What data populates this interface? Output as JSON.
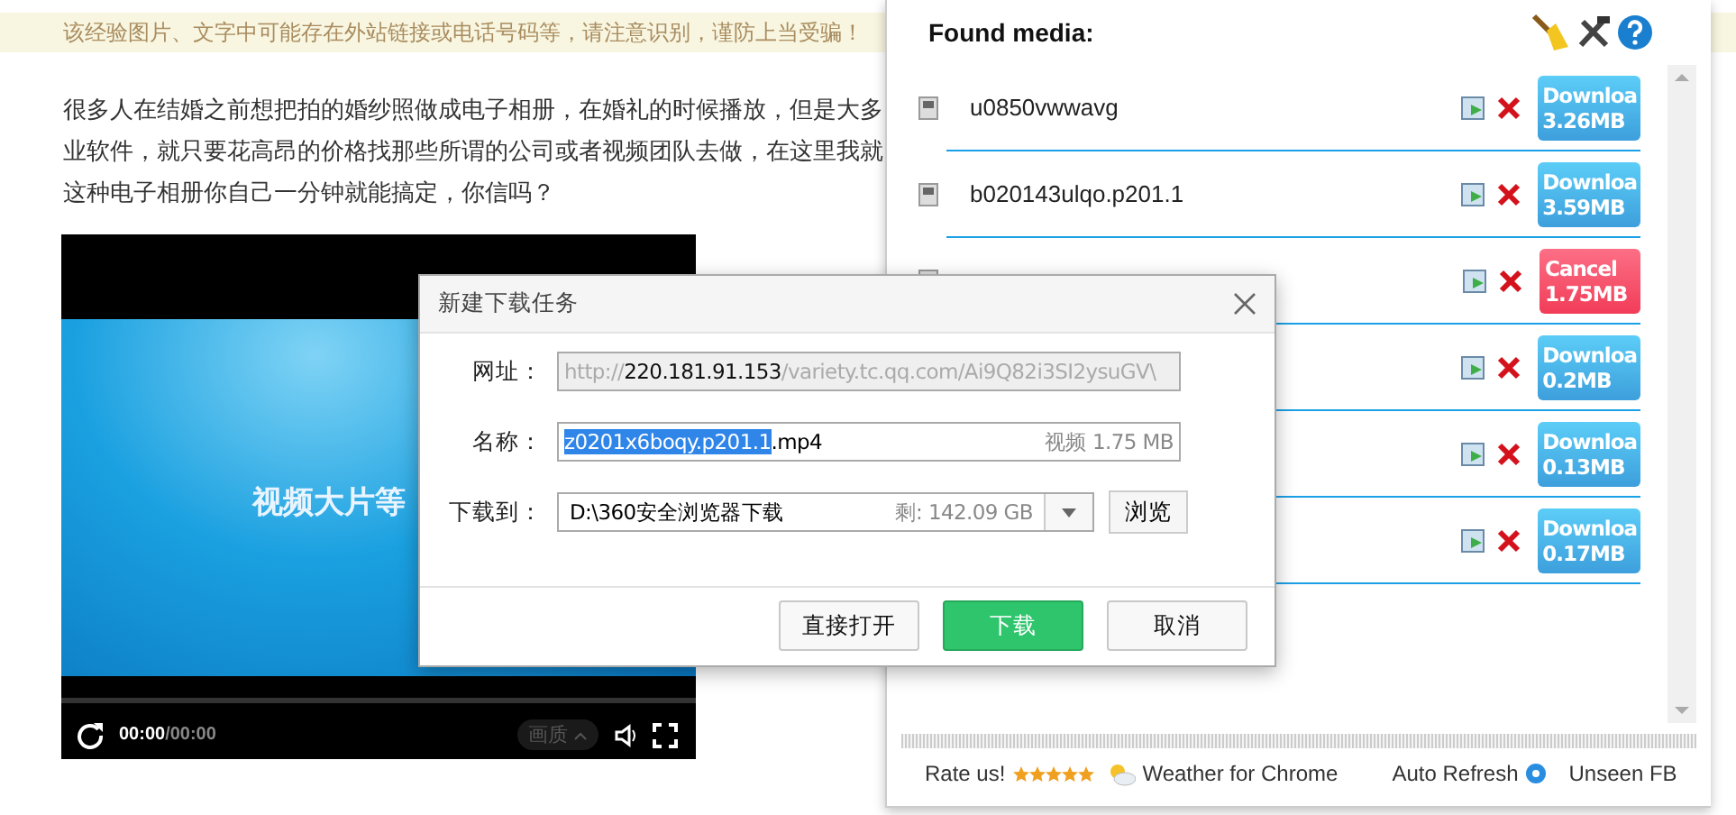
{
  "notice": "该经验图片、文字中可能存在外站链接或电话号码等，请注意识别，谨防上当受骗！",
  "article": {
    "lines": [
      "很多人在结婚之前想把拍的婚纱照做成电子相册，在婚礼的时候播放，但是大多",
      "业软件，就只要花高昂的价格找那些所谓的公司或者视频团队去做，在这里我就",
      "这种电子相册你自己一分钟就能搞定，你信吗？"
    ]
  },
  "video": {
    "caption": "视频大片等",
    "time_current": "00:00",
    "time_total": "/00:00",
    "quality": "画质"
  },
  "media_panel": {
    "title": "Found media:",
    "items": [
      {
        "name": "u0850vwwavg",
        "button": {
          "kind": "download",
          "label": "Downloa",
          "size": "3.26MB"
        }
      },
      {
        "name": "b020143ulqo.p201.1",
        "button": {
          "kind": "download",
          "label": "Downloa",
          "size": "3.59MB"
        }
      },
      {
        "button": {
          "kind": "cancel",
          "label": "Cancel",
          "size": "1.75MB"
        }
      },
      {
        "button": {
          "kind": "download",
          "label": "Downloa",
          "size": "0.2MB"
        }
      },
      {
        "button": {
          "kind": "download",
          "label": "Downloa",
          "size": "0.13MB"
        }
      },
      {
        "button": {
          "kind": "download",
          "label": "Downloa",
          "size": "0.17MB"
        }
      }
    ],
    "footer": {
      "rate": "Rate us!",
      "stars": 5,
      "weather": "Weather for Chrome",
      "auto_refresh": "Auto Refresh",
      "unseen": "Unseen FB"
    }
  },
  "dialog": {
    "title": "新建下载任务",
    "url_label": "网址：",
    "url": {
      "scheme": "http://",
      "host": "220.181.91.153",
      "path": "/variety.tc.qq.com/Ai9Q82i3SI2ysuGV\\"
    },
    "name_label": "名称：",
    "name": {
      "selected": "z0201x6boqy.p201.1",
      "rest": ".mp4",
      "info": "视频 1.75 MB"
    },
    "path_label": "下载到：",
    "path": {
      "value": "D:\\360安全浏览器下载",
      "free": "剩: 142.09 GB"
    },
    "browse": "浏览",
    "buttons": [
      {
        "kind": "plain",
        "label": "直接打开"
      },
      {
        "kind": "primary",
        "label": "下载"
      },
      {
        "kind": "plain",
        "label": "取消"
      }
    ]
  }
}
